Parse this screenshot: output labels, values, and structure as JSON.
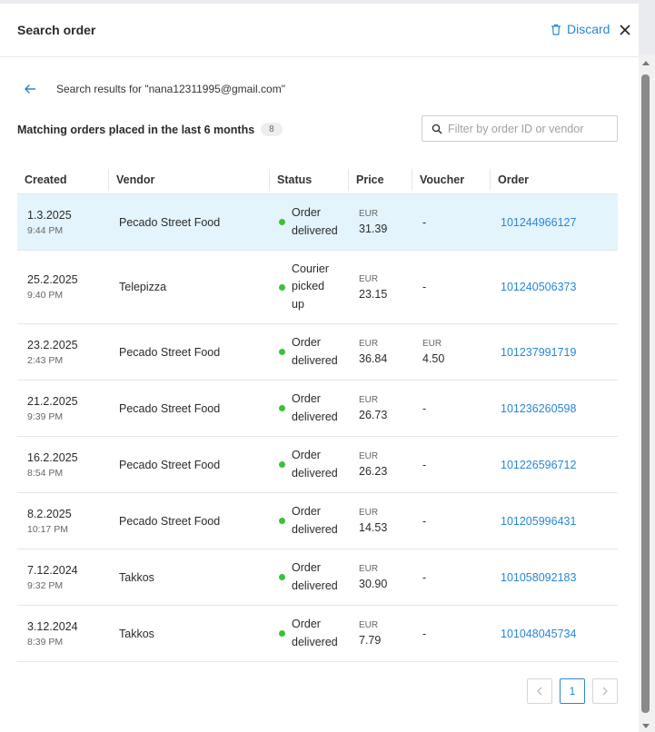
{
  "header": {
    "title": "Search order",
    "discard_label": "Discard"
  },
  "results": {
    "text": "Search results for \"nana12311995@gmail.com\""
  },
  "matching": {
    "label": "Matching orders placed in the last 6 months",
    "count": "8"
  },
  "filter": {
    "placeholder": "Filter by order ID or vendor"
  },
  "columns": [
    "Created",
    "Vendor",
    "Status",
    "Price",
    "Voucher",
    "Order"
  ],
  "rows": [
    {
      "date": "1.3.2025",
      "time": "9:44 PM",
      "vendor": "Pecado Street Food",
      "status": [
        "Order",
        "delivered"
      ],
      "currency": "EUR",
      "price": "31.39",
      "voucher_currency": "",
      "voucher": "-",
      "order": "101244966127",
      "selected": true
    },
    {
      "date": "25.2.2025",
      "time": "9:40 PM",
      "vendor": "Telepizza",
      "status": [
        "Courier",
        "picked",
        "up"
      ],
      "currency": "EUR",
      "price": "23.15",
      "voucher_currency": "",
      "voucher": "-",
      "order": "101240506373"
    },
    {
      "date": "23.2.2025",
      "time": "2:43 PM",
      "vendor": "Pecado Street Food",
      "status": [
        "Order",
        "delivered"
      ],
      "currency": "EUR",
      "price": "36.84",
      "voucher_currency": "EUR",
      "voucher": "4.50",
      "order": "101237991719"
    },
    {
      "date": "21.2.2025",
      "time": "9:39 PM",
      "vendor": "Pecado Street Food",
      "status": [
        "Order",
        "delivered"
      ],
      "currency": "EUR",
      "price": "26.73",
      "voucher_currency": "",
      "voucher": "-",
      "order": "101236260598"
    },
    {
      "date": "16.2.2025",
      "time": "8:54 PM",
      "vendor": "Pecado Street Food",
      "status": [
        "Order",
        "delivered"
      ],
      "currency": "EUR",
      "price": "26.23",
      "voucher_currency": "",
      "voucher": "-",
      "order": "101226596712"
    },
    {
      "date": "8.2.2025",
      "time": "10:17 PM",
      "vendor": "Pecado Street Food",
      "status": [
        "Order",
        "delivered"
      ],
      "currency": "EUR",
      "price": "14.53",
      "voucher_currency": "",
      "voucher": "-",
      "order": "101205996431"
    },
    {
      "date": "7.12.2024",
      "time": "9:32 PM",
      "vendor": "Takkos",
      "status": [
        "Order",
        "delivered"
      ],
      "currency": "EUR",
      "price": "30.90",
      "voucher_currency": "",
      "voucher": "-",
      "order": "101058092183"
    },
    {
      "date": "3.12.2024",
      "time": "8:39 PM",
      "vendor": "Takkos",
      "status": [
        "Order",
        "delivered"
      ],
      "currency": "EUR",
      "price": "7.79",
      "voucher_currency": "",
      "voucher": "-",
      "order": "101048045734"
    }
  ],
  "pagination": {
    "current_page": "1"
  },
  "colors": {
    "accent": "#2a86d6",
    "selected_row": "#e4f4fc",
    "status_dot": "#3ac13a"
  },
  "icons": {
    "discard": "trash-icon",
    "close": "close-icon",
    "back": "arrow-left-icon",
    "search": "search-icon"
  }
}
